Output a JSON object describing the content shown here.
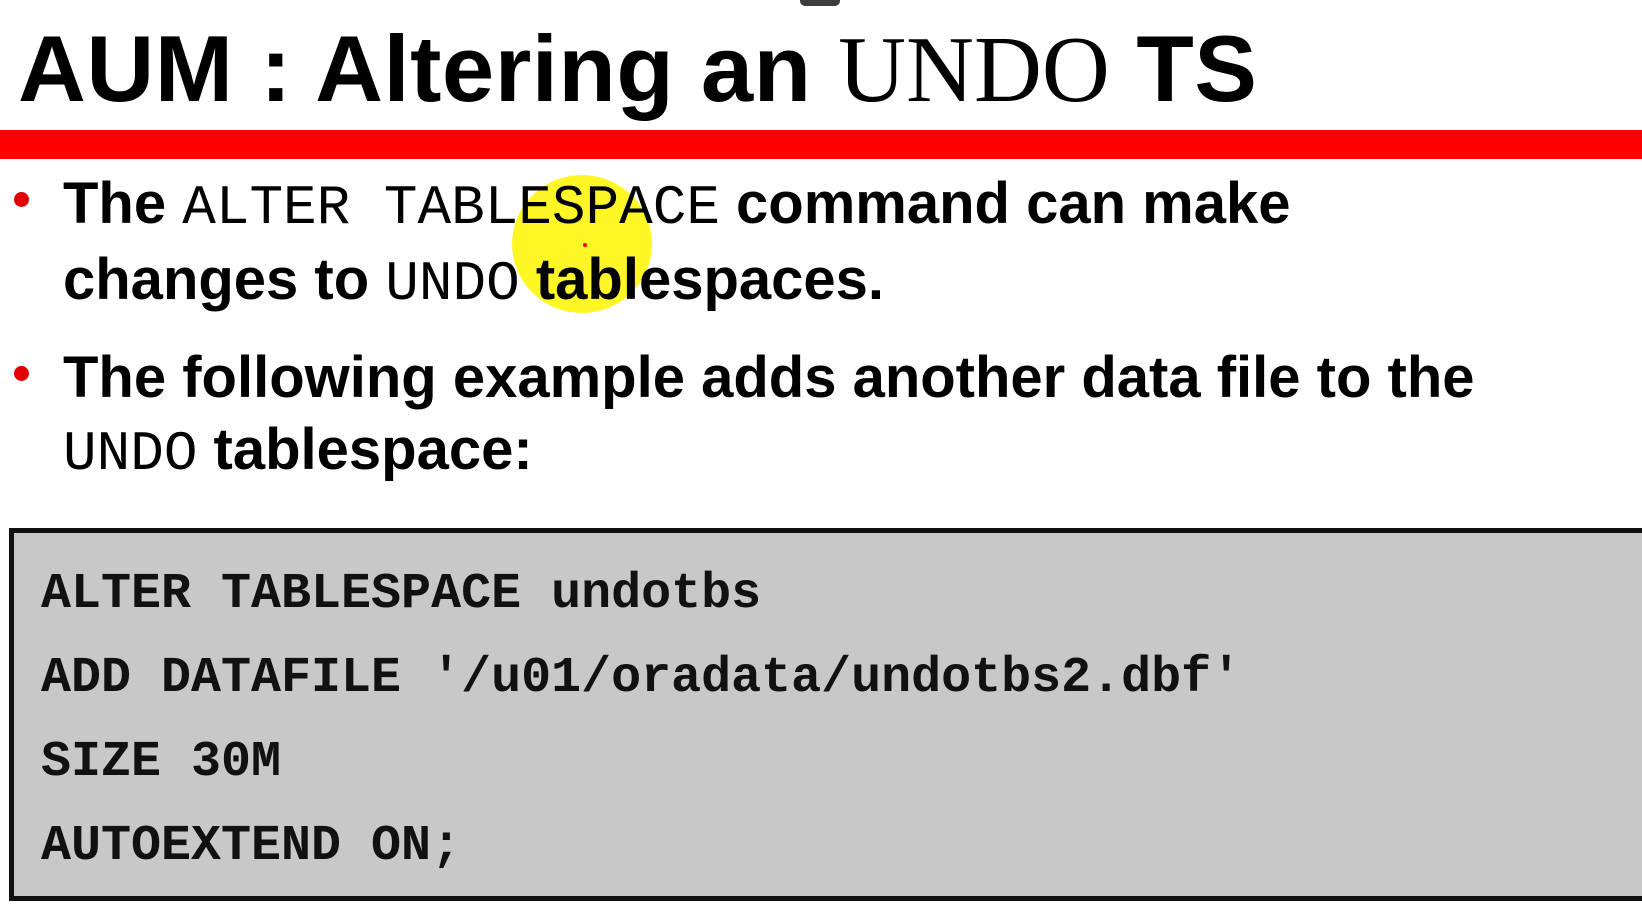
{
  "slide": {
    "title": {
      "prefix": "AUM : Altering an ",
      "undo": "UNDO",
      "suffix": " TS"
    },
    "bullets": [
      {
        "text1": "The ",
        "code1": "ALTER TABLESPACE",
        "text2": " command can make",
        "text3": "changes to ",
        "code2": "UNDO",
        "text4": " tablespaces."
      },
      {
        "text1": "The following example adds another data file to the",
        "code1": "UNDO",
        "text2": " tablespace:"
      }
    ],
    "code": [
      "ALTER TABLESPACE undotbs",
      "ADD DATAFILE '/u01/oradata/undotbs2.dbf'",
      "SIZE 30M",
      "AUTOEXTEND ON;"
    ]
  },
  "colors": {
    "accent_rule": "#ff0000",
    "bullet": "#e00000",
    "code_background": "#c8c8c8",
    "cursor_highlight": "#fff500"
  }
}
